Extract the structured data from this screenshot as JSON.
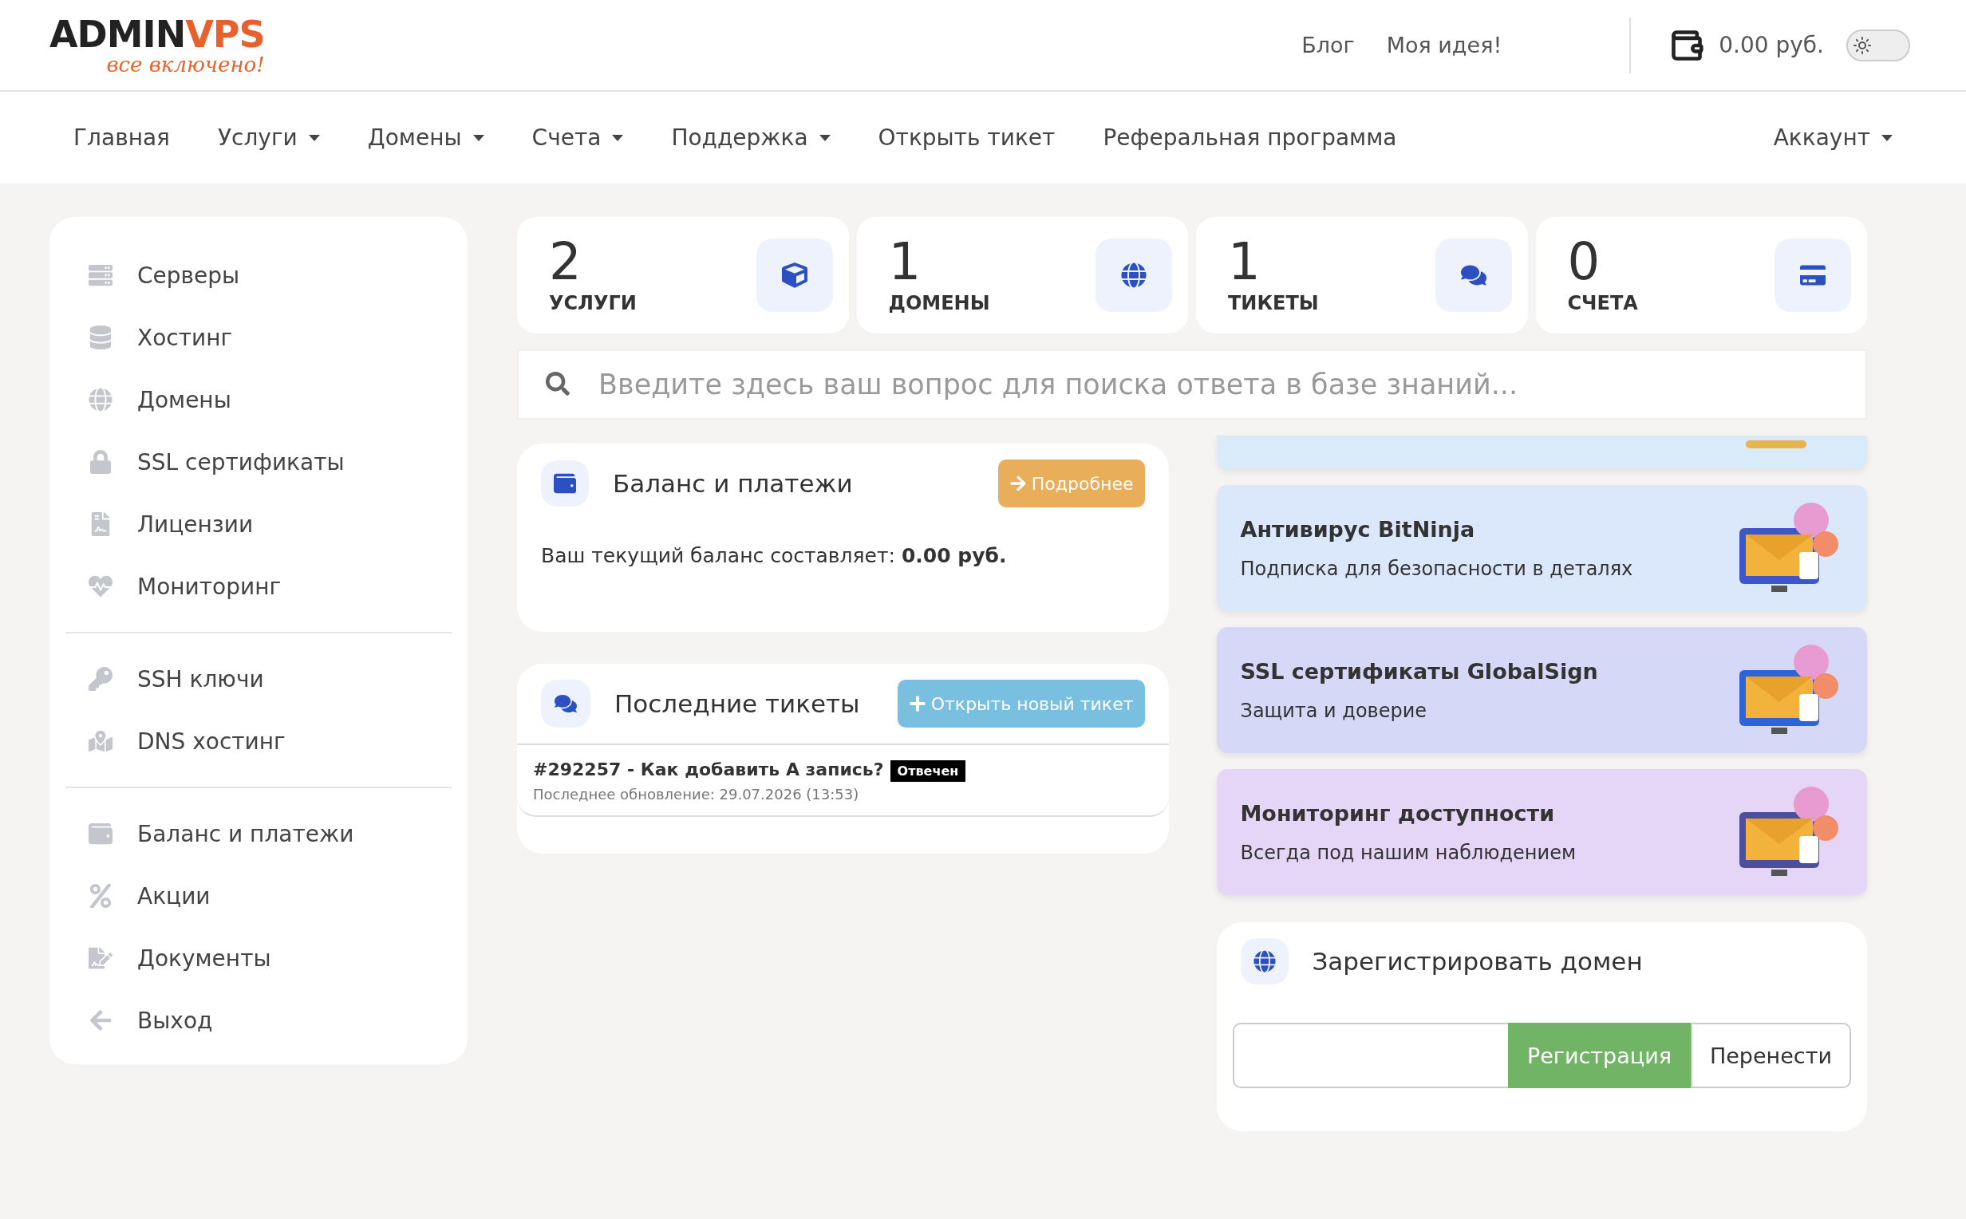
{
  "logo": {
    "dark": "ADMIN",
    "accent": "VPS",
    "tagline": "все включено!"
  },
  "header": {
    "links": [
      "Блог",
      "Моя идея!"
    ],
    "balance": "0.00 руб.",
    "theme_toggle": {
      "on": false
    }
  },
  "nav": {
    "items": [
      {
        "label": "Главная",
        "dropdown": false
      },
      {
        "label": "Услуги",
        "dropdown": true
      },
      {
        "label": "Домены",
        "dropdown": true
      },
      {
        "label": "Счета",
        "dropdown": true
      },
      {
        "label": "Поддержка",
        "dropdown": true
      },
      {
        "label": "Открыть тикет",
        "dropdown": false
      },
      {
        "label": "Реферальная программа",
        "dropdown": false
      }
    ],
    "account": {
      "label": "Аккаунт",
      "dropdown": true
    }
  },
  "sidebar": {
    "groups": [
      {
        "items": [
          "Серверы",
          "Хостинг",
          "Домены",
          "SSL сертификаты",
          "Лицензии",
          "Мониторинг"
        ]
      },
      {
        "items": [
          "SSH ключи",
          "DNS хостинг"
        ]
      },
      {
        "items": [
          "Баланс и платежи",
          "Акции",
          "Документы",
          "Выход"
        ]
      }
    ]
  },
  "stats": [
    {
      "value": "2",
      "label": "УСЛУГИ"
    },
    {
      "value": "1",
      "label": "ДОМЕНЫ"
    },
    {
      "value": "1",
      "label": "ТИКЕТЫ"
    },
    {
      "value": "0",
      "label": "СЧЕТА"
    }
  ],
  "search": {
    "placeholder": "Введите здесь ваш вопрос для поиска ответа в базе знаний..."
  },
  "balance_card": {
    "title": "Баланс и платежи",
    "button": "Подробнее",
    "text": "Ваш текущий баланс составляет: **0.00 руб.**"
  },
  "tickets_card": {
    "title": "Последние тикеты",
    "button": "Открыть новый тикет",
    "tickets": [
      {
        "title": "#292257 - Как добавить А запись?",
        "status": "Отвечен",
        "updated": "Последнее обновление: 29.07.2026 (13:53)"
      }
    ]
  },
  "promos": [
    {
      "kind": "cut",
      "color": "#d9ebf8"
    },
    {
      "kind": "banner",
      "color": "#dbe7fb",
      "title": "Антивирус BitNinja",
      "subtitle": "Подписка для безопасности в деталях"
    },
    {
      "kind": "banner",
      "color": "#d6d8f8",
      "title": "SSL сертификаты GlobalSign",
      "subtitle": "Защита и доверие"
    },
    {
      "kind": "banner",
      "color": "#e5d6f8",
      "title": "Мониторинг доступности",
      "subtitle": "Всегда под нашим наблюдением"
    }
  ],
  "domain_card": {
    "title": "Зарегистрировать домен",
    "buttons": [
      "Регистрация",
      "Перенести"
    ]
  }
}
